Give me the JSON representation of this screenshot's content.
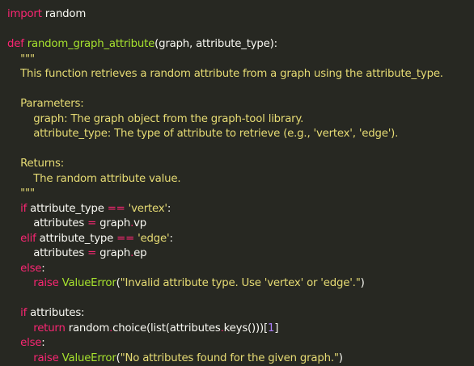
{
  "editor": {
    "colors": {
      "background": "#272822",
      "text": "#f8f8f2",
      "keyword": "#f92672",
      "function": "#a6e22e",
      "string": "#e6db74",
      "number": "#ae81ff"
    },
    "lines": [
      [
        {
          "t": "import",
          "c": "kw"
        },
        {
          "t": " random",
          "c": "txt"
        }
      ],
      [],
      [
        {
          "t": "def",
          "c": "kw"
        },
        {
          "t": " ",
          "c": "txt"
        },
        {
          "t": "random_graph_attribute",
          "c": "fn"
        },
        {
          "t": "(graph, attribute_type):",
          "c": "txt"
        }
      ],
      [
        {
          "t": "    \"\"\"",
          "c": "str"
        }
      ],
      [
        {
          "t": "    This function retrieves a random attribute from a graph using the attribute_type.",
          "c": "str"
        }
      ],
      [],
      [
        {
          "t": "    Parameters:",
          "c": "str"
        }
      ],
      [
        {
          "t": "        graph: The graph object from the graph-tool library.",
          "c": "str"
        }
      ],
      [
        {
          "t": "        attribute_type: The type of attribute to retrieve (e.g., 'vertex', 'edge').",
          "c": "str"
        }
      ],
      [],
      [
        {
          "t": "    Returns:",
          "c": "str"
        }
      ],
      [
        {
          "t": "        The random attribute value.",
          "c": "str"
        }
      ],
      [
        {
          "t": "    \"\"\"",
          "c": "str"
        }
      ],
      [
        {
          "t": "    ",
          "c": "txt"
        },
        {
          "t": "if",
          "c": "kw"
        },
        {
          "t": " attribute_type ",
          "c": "txt"
        },
        {
          "t": "==",
          "c": "op"
        },
        {
          "t": " ",
          "c": "txt"
        },
        {
          "t": "'vertex'",
          "c": "str"
        },
        {
          "t": ":",
          "c": "txt"
        }
      ],
      [
        {
          "t": "        attributes ",
          "c": "txt"
        },
        {
          "t": "=",
          "c": "op"
        },
        {
          "t": " graph",
          "c": "txt"
        },
        {
          "t": ".",
          "c": "op"
        },
        {
          "t": "vp",
          "c": "txt"
        }
      ],
      [
        {
          "t": "    ",
          "c": "txt"
        },
        {
          "t": "elif",
          "c": "kw"
        },
        {
          "t": " attribute_type ",
          "c": "txt"
        },
        {
          "t": "==",
          "c": "op"
        },
        {
          "t": " ",
          "c": "txt"
        },
        {
          "t": "'edge'",
          "c": "str"
        },
        {
          "t": ":",
          "c": "txt"
        }
      ],
      [
        {
          "t": "        attributes ",
          "c": "txt"
        },
        {
          "t": "=",
          "c": "op"
        },
        {
          "t": " graph",
          "c": "txt"
        },
        {
          "t": ".",
          "c": "op"
        },
        {
          "t": "ep",
          "c": "txt"
        }
      ],
      [
        {
          "t": "    ",
          "c": "txt"
        },
        {
          "t": "else",
          "c": "kw"
        },
        {
          "t": ":",
          "c": "txt"
        }
      ],
      [
        {
          "t": "        ",
          "c": "txt"
        },
        {
          "t": "raise",
          "c": "kw"
        },
        {
          "t": " ",
          "c": "txt"
        },
        {
          "t": "ValueError",
          "c": "fn"
        },
        {
          "t": "(",
          "c": "txt"
        },
        {
          "t": "\"Invalid attribute type. Use 'vertex' or 'edge'.\"",
          "c": "str"
        },
        {
          "t": ")",
          "c": "txt"
        }
      ],
      [],
      [
        {
          "t": "    ",
          "c": "txt"
        },
        {
          "t": "if",
          "c": "kw"
        },
        {
          "t": " attributes:",
          "c": "txt"
        }
      ],
      [
        {
          "t": "        ",
          "c": "txt"
        },
        {
          "t": "return",
          "c": "kw"
        },
        {
          "t": " random",
          "c": "txt"
        },
        {
          "t": ".",
          "c": "op"
        },
        {
          "t": "choice(list(attributes",
          "c": "txt"
        },
        {
          "t": ".",
          "c": "op"
        },
        {
          "t": "keys()))[",
          "c": "txt"
        },
        {
          "t": "1",
          "c": "num"
        },
        {
          "t": "]",
          "c": "txt"
        }
      ],
      [
        {
          "t": "    ",
          "c": "txt"
        },
        {
          "t": "else",
          "c": "kw"
        },
        {
          "t": ":",
          "c": "txt"
        }
      ],
      [
        {
          "t": "        ",
          "c": "txt"
        },
        {
          "t": "raise",
          "c": "kw"
        },
        {
          "t": " ",
          "c": "txt"
        },
        {
          "t": "ValueError",
          "c": "fn"
        },
        {
          "t": "(",
          "c": "txt"
        },
        {
          "t": "\"No attributes found for the given graph.\"",
          "c": "str"
        },
        {
          "t": ")",
          "c": "txt"
        }
      ]
    ]
  }
}
